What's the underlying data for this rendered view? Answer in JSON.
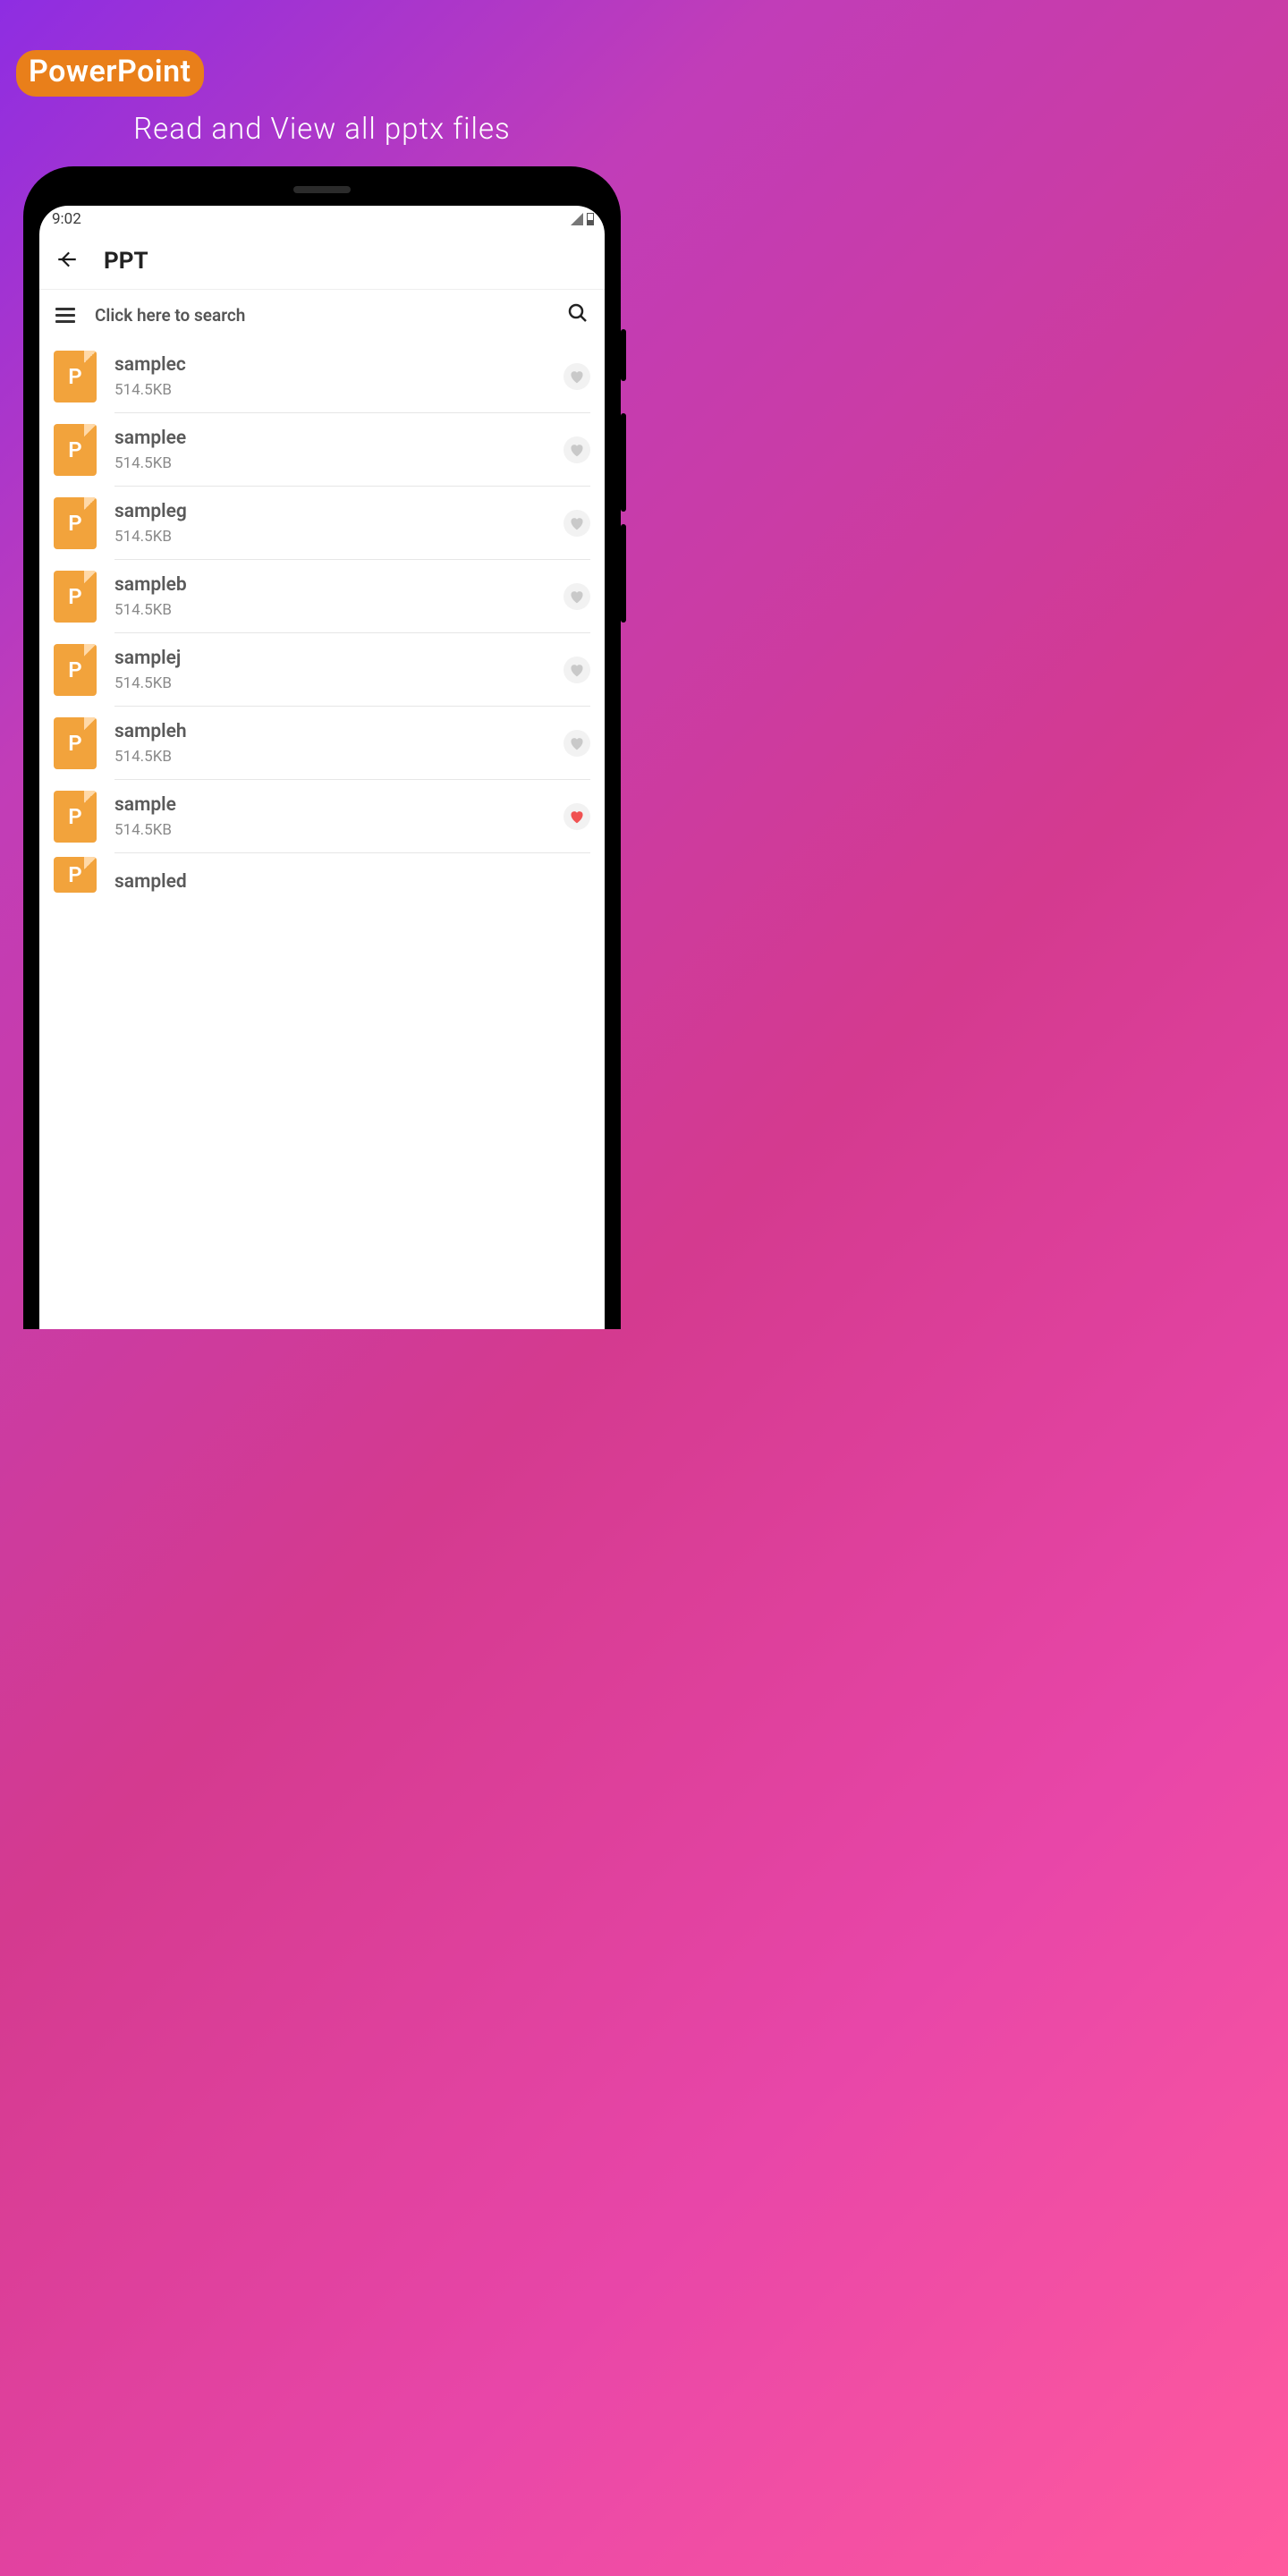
{
  "badge": {
    "text": "PowerPoint"
  },
  "headline": "Read and View all pptx files",
  "statusbar": {
    "time": "9:02"
  },
  "appbar": {
    "title": "PPT"
  },
  "search": {
    "placeholder": "Click here to search"
  },
  "file_icon_letter": "P",
  "files": [
    {
      "name": "samplec",
      "size": "514.5KB",
      "favorite": false
    },
    {
      "name": "samplee",
      "size": "514.5KB",
      "favorite": false
    },
    {
      "name": "sampleg",
      "size": "514.5KB",
      "favorite": false
    },
    {
      "name": "sampleb",
      "size": "514.5KB",
      "favorite": false
    },
    {
      "name": "samplej",
      "size": "514.5KB",
      "favorite": false
    },
    {
      "name": "sampleh",
      "size": "514.5KB",
      "favorite": false
    },
    {
      "name": "sample",
      "size": "514.5KB",
      "favorite": true
    },
    {
      "name": "sampled",
      "size": "",
      "favorite": false
    }
  ]
}
